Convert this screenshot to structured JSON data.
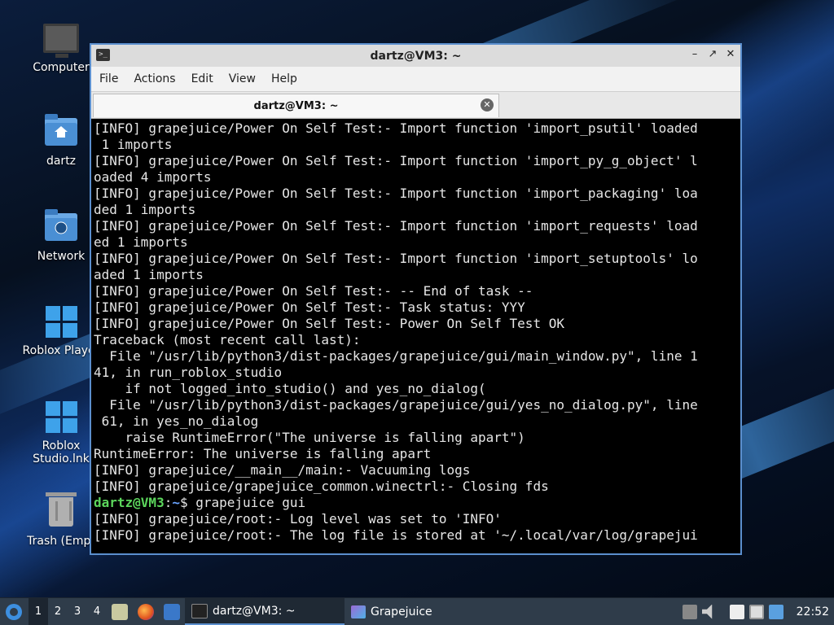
{
  "desktop": {
    "icons": [
      {
        "label": "Computer",
        "icon": "computer-icon"
      },
      {
        "label": "dartz",
        "icon": "home-folder-icon"
      },
      {
        "label": "Network",
        "icon": "network-folder-icon"
      },
      {
        "label": "Roblox Player",
        "icon": "roblox-player-icon"
      },
      {
        "label": "Roblox Studio.lnk",
        "icon": "roblox-studio-icon"
      },
      {
        "label": "Trash (Empt",
        "icon": "trash-icon"
      }
    ]
  },
  "window": {
    "title": "dartz@VM3: ~",
    "menu": [
      "File",
      "Actions",
      "Edit",
      "View",
      "Help"
    ],
    "tab_label": "dartz@VM3: ~",
    "terminal_lines": [
      "[INFO] grapejuice/Power On Self Test:- Import function 'import_psutil' loaded",
      " 1 imports",
      "[INFO] grapejuice/Power On Self Test:- Import function 'import_py_g_object' l",
      "oaded 4 imports",
      "[INFO] grapejuice/Power On Self Test:- Import function 'import_packaging' loa",
      "ded 1 imports",
      "[INFO] grapejuice/Power On Self Test:- Import function 'import_requests' load",
      "ed 1 imports",
      "[INFO] grapejuice/Power On Self Test:- Import function 'import_setuptools' lo",
      "aded 1 imports",
      "[INFO] grapejuice/Power On Self Test:- -- End of task --",
      "[INFO] grapejuice/Power On Self Test:- Task status: YYY",
      "[INFO] grapejuice/Power On Self Test:- Power On Self Test OK",
      "Traceback (most recent call last):",
      "  File \"/usr/lib/python3/dist-packages/grapejuice/gui/main_window.py\", line 1",
      "41, in run_roblox_studio",
      "    if not logged_into_studio() and yes_no_dialog(",
      "  File \"/usr/lib/python3/dist-packages/grapejuice/gui/yes_no_dialog.py\", line",
      " 61, in yes_no_dialog",
      "    raise RuntimeError(\"The universe is falling apart\")",
      "RuntimeError: The universe is falling apart",
      "[INFO] grapejuice/__main__/main:- Vacuuming logs",
      "[INFO] grapejuice/grapejuice_common.winectrl:- Closing fds"
    ],
    "prompt_user": "dartz@VM3",
    "prompt_sep": ":",
    "prompt_path": "~",
    "prompt_cmd": "$ grapejuice gui",
    "trailing_lines": [
      "[INFO] grapejuice/root:- Log level was set to 'INFO'",
      "[INFO] grapejuice/root:- The log file is stored at '~/.local/var/log/grapejui"
    ]
  },
  "taskbar": {
    "workspaces": [
      "1",
      "2",
      "3",
      "4"
    ],
    "active_workspace": "1",
    "tasks": [
      {
        "label": "dartz@VM3: ~",
        "icon": "terminal-icon",
        "active": true
      },
      {
        "label": "Grapejuice",
        "icon": "grapejuice-icon",
        "active": false
      }
    ],
    "clock": "22:52"
  },
  "colors": {
    "window_border": "#5b8fce",
    "prompt_user": "#5cd65c",
    "prompt_path": "#6aa3ff"
  }
}
